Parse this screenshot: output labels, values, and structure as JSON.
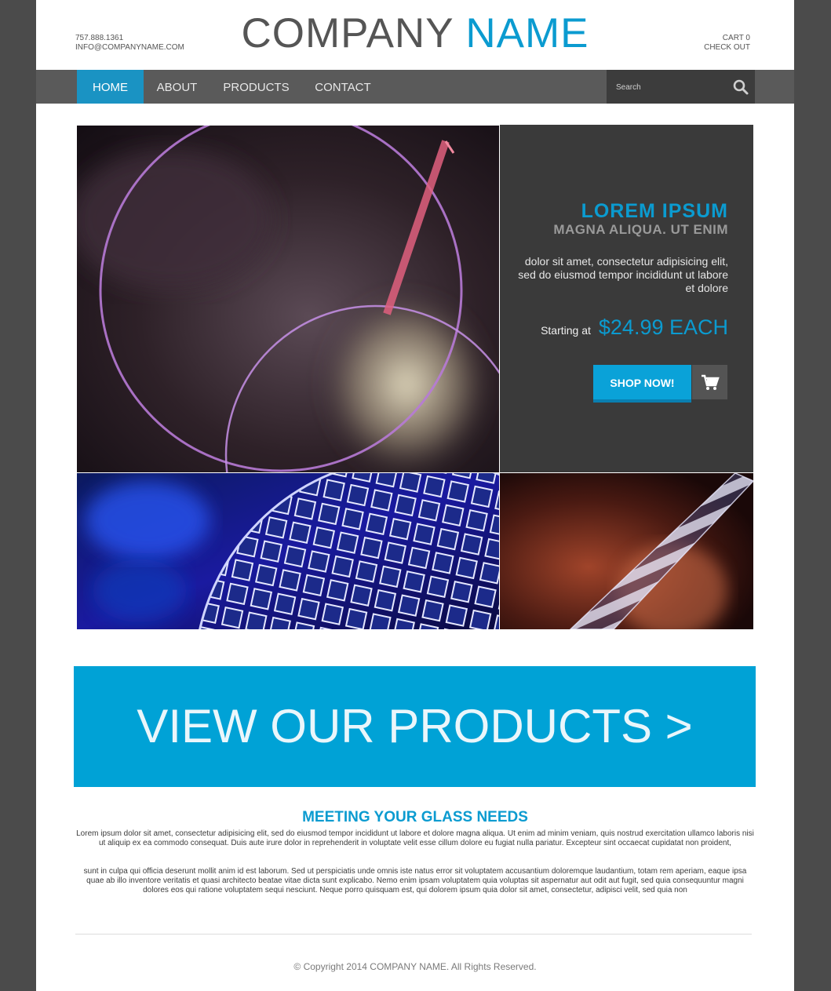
{
  "header": {
    "phone": "757.888.1361",
    "email": "INFO@COMPANYNAME.COM",
    "logo_part1": "COMPANY ",
    "logo_part2": "NAME",
    "cart_label": "CART  0",
    "checkout_label": "CHECK OUT"
  },
  "nav": {
    "items": [
      {
        "label": "HOME",
        "active": true
      },
      {
        "label": "ABOUT",
        "active": false
      },
      {
        "label": "PRODUCTS",
        "active": false
      },
      {
        "label": "CONTACT",
        "active": false
      }
    ],
    "search_placeholder": "Search"
  },
  "hero": {
    "title": "LOREM IPSUM",
    "subtitle": "MAGNA ALIQUA. UT ENIM",
    "text": "dolor sit amet, consectetur adipisicing elit, sed do eiusmod tempor incididunt ut labore et dolore",
    "price_label": "Starting at",
    "price_value": "$24.99 EACH",
    "shop_button": "SHOP NOW!"
  },
  "banner": {
    "text": "VIEW OUR PRODUCTS >"
  },
  "content": {
    "heading": "MEETING YOUR GLASS NEEDS",
    "paragraph1": "Lorem ipsum dolor sit amet, consectetur adipisicing elit, sed do eiusmod tempor incididunt ut labore et dolore magna aliqua. Ut enim ad minim veniam, quis nostrud exercitation ullamco laboris nisi ut aliquip ex ea commodo consequat. Duis aute irure dolor in reprehenderit in voluptate velit esse cillum dolore eu fugiat nulla pariatur. Excepteur sint occaecat cupidatat non proident,",
    "paragraph2": "sunt in culpa qui officia deserunt mollit anim id est laborum. Sed ut perspiciatis unde omnis iste natus error sit voluptatem accusantium doloremque laudantium, totam rem aperiam, eaque ipsa quae ab illo inventore veritatis et quasi architecto beatae vitae dicta sunt explicabo. Nemo enim ipsam voluptatem quia voluptas sit aspernatur aut odit aut fugit, sed quia consequuntur magni dolores eos qui ratione voluptatem sequi nesciunt. Neque porro quisquam est, qui dolorem ipsum quia dolor sit amet, consectetur, adipisci velit, sed quia non"
  },
  "footer": {
    "copyright": "© Copyright 2014 COMPANY NAME. All Rights Reserved."
  },
  "colors": {
    "accent": "#0b9bd0",
    "banner": "#00a2d6",
    "nav_bg": "#5a5a5a",
    "page_bg": "#4b4b4b"
  }
}
